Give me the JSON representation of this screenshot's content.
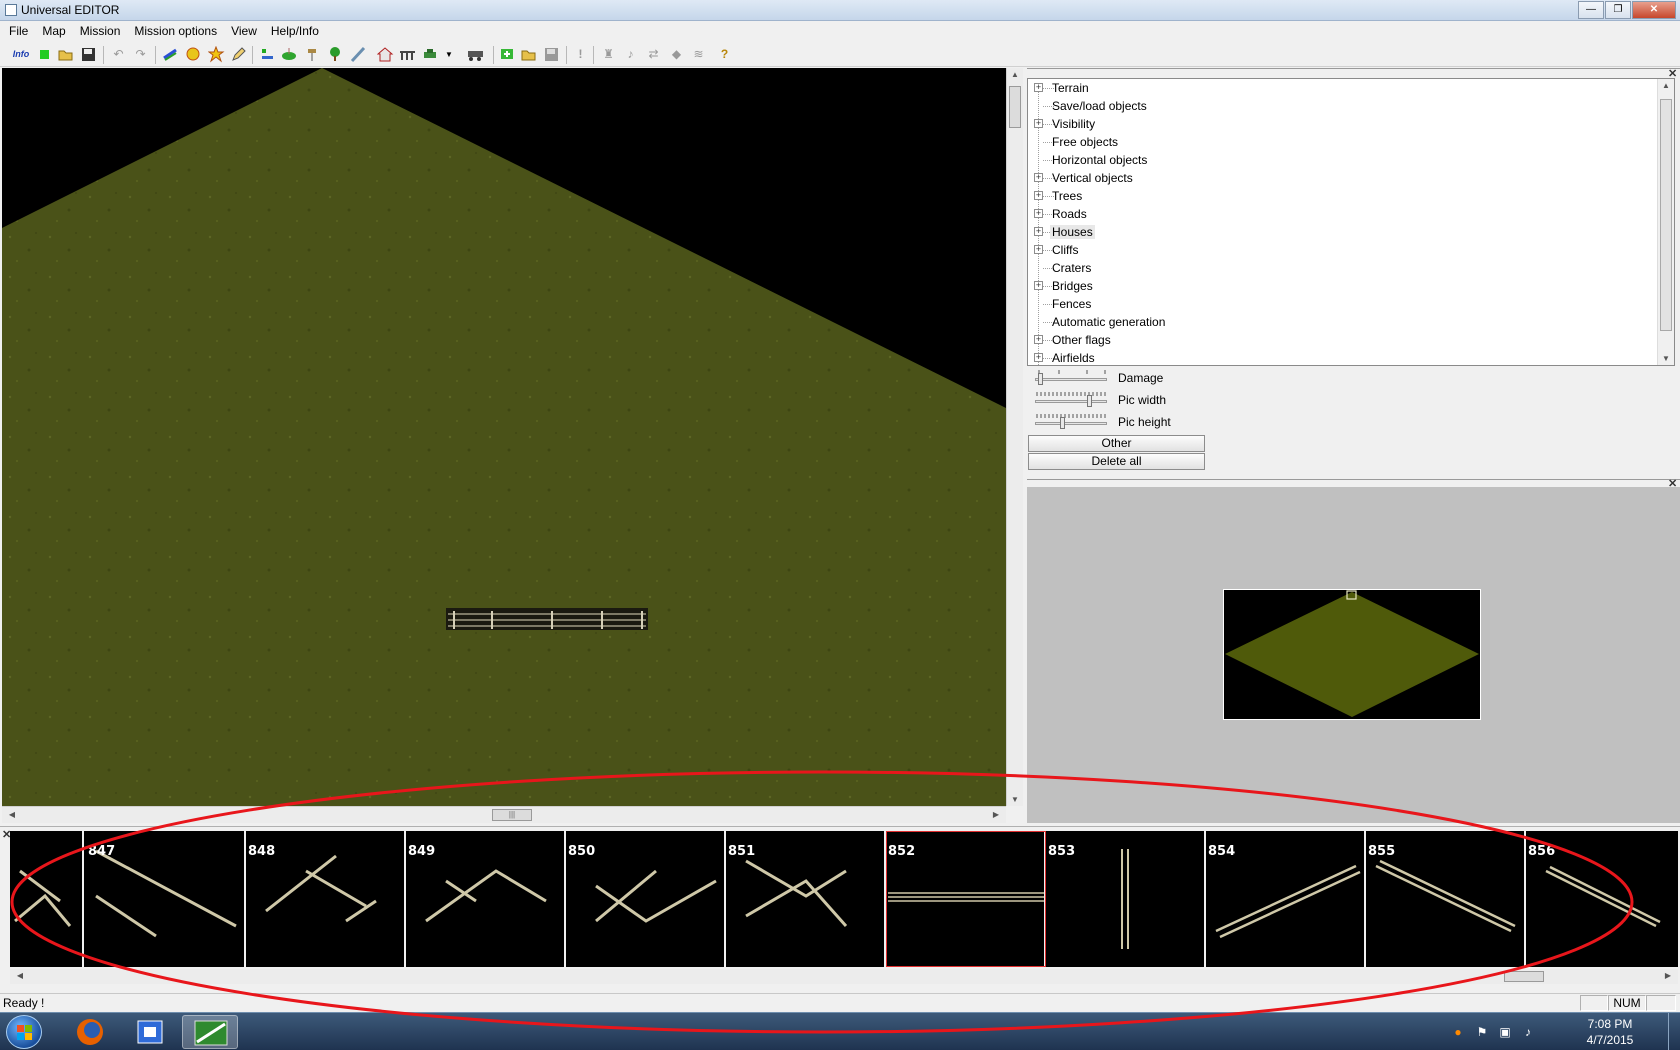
{
  "window": {
    "title": "Universal EDITOR",
    "minimize": "—",
    "maximize": "❐",
    "close": "✕"
  },
  "menu": [
    "File",
    "Map",
    "Mission",
    "Mission options",
    "View",
    "Help/Info"
  ],
  "toolbar": {
    "info_label": "Info",
    "icons": [
      "new-green-square-icon",
      "open-folder-icon",
      "save-disk-icon",
      "undo-icon",
      "redo-icon",
      "fence-tool-icon",
      "explosion-tool-icon",
      "explosion-burst-icon",
      "pencil-tool-icon",
      "align-icon",
      "bush-icon",
      "signpost-icon",
      "tree-icon",
      "road-icon",
      "house-icon",
      "bridge-icon",
      "vehicle-icon",
      "dropdown-arrow-icon",
      "train-icon",
      "add-green-icon",
      "folder-open-icon",
      "save-gray-icon",
      "exclamation-icon",
      "unit-icon",
      "sound-icon",
      "shuffle-icon",
      "diamond-icon",
      "spring-icon",
      "help-question-icon"
    ]
  },
  "tree": {
    "items": [
      {
        "label": "Terrain",
        "expandable": true
      },
      {
        "label": "Save/load objects",
        "expandable": false
      },
      {
        "label": "Visibility",
        "expandable": true
      },
      {
        "label": "Free objects",
        "expandable": false
      },
      {
        "label": "Horizontal objects",
        "expandable": false
      },
      {
        "label": "Vertical objects",
        "expandable": true
      },
      {
        "label": "Trees",
        "expandable": true
      },
      {
        "label": "Roads",
        "expandable": true
      },
      {
        "label": "Houses",
        "expandable": true,
        "selected": true
      },
      {
        "label": "Cliffs",
        "expandable": true
      },
      {
        "label": "Craters",
        "expandable": false
      },
      {
        "label": "Bridges",
        "expandable": true
      },
      {
        "label": "Fences",
        "expandable": false
      },
      {
        "label": "Automatic generation",
        "expandable": false
      },
      {
        "label": "Other flags",
        "expandable": true
      },
      {
        "label": "Airfields",
        "expandable": true
      }
    ]
  },
  "sliders": [
    {
      "label": "Damage",
      "value": 0.05
    },
    {
      "label": "Pic width",
      "value": 0.78
    },
    {
      "label": "Pic height",
      "value": 0.38
    }
  ],
  "buttons": {
    "other": "Other",
    "delete_all": "Delete all"
  },
  "strip": {
    "tiles": [
      {
        "num": ""
      },
      {
        "num": "847"
      },
      {
        "num": "848"
      },
      {
        "num": "849"
      },
      {
        "num": "850"
      },
      {
        "num": "851"
      },
      {
        "num": "852",
        "selected": true
      },
      {
        "num": "853"
      },
      {
        "num": "854"
      },
      {
        "num": "855"
      },
      {
        "num": "856"
      }
    ]
  },
  "status": {
    "message": "Ready !",
    "num": "NUM"
  },
  "taskbar": {
    "time": "7:08 PM",
    "date": "4/7/2015"
  },
  "colors": {
    "terrain": "#4a5218",
    "minimap_terrain": "#4f5a0a",
    "selection_red": "#e03030",
    "annotation_red": "#e8161b"
  }
}
